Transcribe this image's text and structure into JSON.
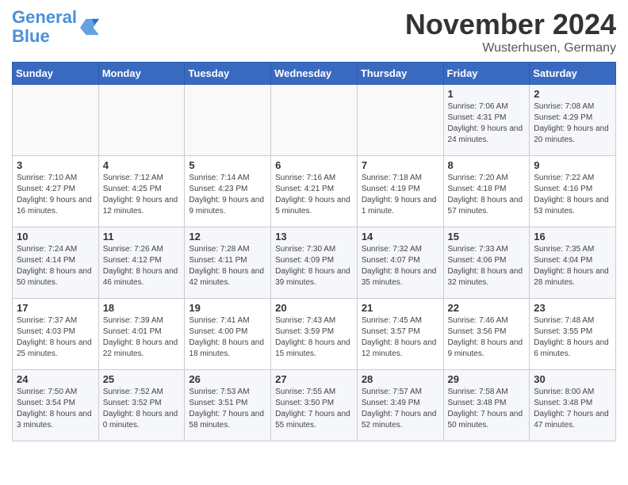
{
  "header": {
    "logo_line1": "General",
    "logo_line2": "Blue",
    "month_title": "November 2024",
    "location": "Wusterhusen, Germany"
  },
  "columns": [
    "Sunday",
    "Monday",
    "Tuesday",
    "Wednesday",
    "Thursday",
    "Friday",
    "Saturday"
  ],
  "weeks": [
    [
      {
        "day": "",
        "info": ""
      },
      {
        "day": "",
        "info": ""
      },
      {
        "day": "",
        "info": ""
      },
      {
        "day": "",
        "info": ""
      },
      {
        "day": "",
        "info": ""
      },
      {
        "day": "1",
        "info": "Sunrise: 7:06 AM\nSunset: 4:31 PM\nDaylight: 9 hours and 24 minutes."
      },
      {
        "day": "2",
        "info": "Sunrise: 7:08 AM\nSunset: 4:29 PM\nDaylight: 9 hours and 20 minutes."
      }
    ],
    [
      {
        "day": "3",
        "info": "Sunrise: 7:10 AM\nSunset: 4:27 PM\nDaylight: 9 hours and 16 minutes."
      },
      {
        "day": "4",
        "info": "Sunrise: 7:12 AM\nSunset: 4:25 PM\nDaylight: 9 hours and 12 minutes."
      },
      {
        "day": "5",
        "info": "Sunrise: 7:14 AM\nSunset: 4:23 PM\nDaylight: 9 hours and 9 minutes."
      },
      {
        "day": "6",
        "info": "Sunrise: 7:16 AM\nSunset: 4:21 PM\nDaylight: 9 hours and 5 minutes."
      },
      {
        "day": "7",
        "info": "Sunrise: 7:18 AM\nSunset: 4:19 PM\nDaylight: 9 hours and 1 minute."
      },
      {
        "day": "8",
        "info": "Sunrise: 7:20 AM\nSunset: 4:18 PM\nDaylight: 8 hours and 57 minutes."
      },
      {
        "day": "9",
        "info": "Sunrise: 7:22 AM\nSunset: 4:16 PM\nDaylight: 8 hours and 53 minutes."
      }
    ],
    [
      {
        "day": "10",
        "info": "Sunrise: 7:24 AM\nSunset: 4:14 PM\nDaylight: 8 hours and 50 minutes."
      },
      {
        "day": "11",
        "info": "Sunrise: 7:26 AM\nSunset: 4:12 PM\nDaylight: 8 hours and 46 minutes."
      },
      {
        "day": "12",
        "info": "Sunrise: 7:28 AM\nSunset: 4:11 PM\nDaylight: 8 hours and 42 minutes."
      },
      {
        "day": "13",
        "info": "Sunrise: 7:30 AM\nSunset: 4:09 PM\nDaylight: 8 hours and 39 minutes."
      },
      {
        "day": "14",
        "info": "Sunrise: 7:32 AM\nSunset: 4:07 PM\nDaylight: 8 hours and 35 minutes."
      },
      {
        "day": "15",
        "info": "Sunrise: 7:33 AM\nSunset: 4:06 PM\nDaylight: 8 hours and 32 minutes."
      },
      {
        "day": "16",
        "info": "Sunrise: 7:35 AM\nSunset: 4:04 PM\nDaylight: 8 hours and 28 minutes."
      }
    ],
    [
      {
        "day": "17",
        "info": "Sunrise: 7:37 AM\nSunset: 4:03 PM\nDaylight: 8 hours and 25 minutes."
      },
      {
        "day": "18",
        "info": "Sunrise: 7:39 AM\nSunset: 4:01 PM\nDaylight: 8 hours and 22 minutes."
      },
      {
        "day": "19",
        "info": "Sunrise: 7:41 AM\nSunset: 4:00 PM\nDaylight: 8 hours and 18 minutes."
      },
      {
        "day": "20",
        "info": "Sunrise: 7:43 AM\nSunset: 3:59 PM\nDaylight: 8 hours and 15 minutes."
      },
      {
        "day": "21",
        "info": "Sunrise: 7:45 AM\nSunset: 3:57 PM\nDaylight: 8 hours and 12 minutes."
      },
      {
        "day": "22",
        "info": "Sunrise: 7:46 AM\nSunset: 3:56 PM\nDaylight: 8 hours and 9 minutes."
      },
      {
        "day": "23",
        "info": "Sunrise: 7:48 AM\nSunset: 3:55 PM\nDaylight: 8 hours and 6 minutes."
      }
    ],
    [
      {
        "day": "24",
        "info": "Sunrise: 7:50 AM\nSunset: 3:54 PM\nDaylight: 8 hours and 3 minutes."
      },
      {
        "day": "25",
        "info": "Sunrise: 7:52 AM\nSunset: 3:52 PM\nDaylight: 8 hours and 0 minutes."
      },
      {
        "day": "26",
        "info": "Sunrise: 7:53 AM\nSunset: 3:51 PM\nDaylight: 7 hours and 58 minutes."
      },
      {
        "day": "27",
        "info": "Sunrise: 7:55 AM\nSunset: 3:50 PM\nDaylight: 7 hours and 55 minutes."
      },
      {
        "day": "28",
        "info": "Sunrise: 7:57 AM\nSunset: 3:49 PM\nDaylight: 7 hours and 52 minutes."
      },
      {
        "day": "29",
        "info": "Sunrise: 7:58 AM\nSunset: 3:48 PM\nDaylight: 7 hours and 50 minutes."
      },
      {
        "day": "30",
        "info": "Sunrise: 8:00 AM\nSunset: 3:48 PM\nDaylight: 7 hours and 47 minutes."
      }
    ]
  ]
}
